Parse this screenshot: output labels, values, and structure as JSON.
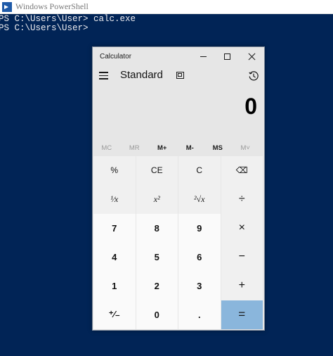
{
  "powershell": {
    "title": "Windows PowerShell",
    "lines": [
      "PS C:\\Users\\User> calc.exe",
      "PS C:\\Users\\User>"
    ]
  },
  "calculator": {
    "title": "Calculator",
    "mode": "Standard",
    "display": "0",
    "memory": [
      "MC",
      "MR",
      "M+",
      "M-",
      "MS",
      "M˅"
    ],
    "keys": {
      "percent": "%",
      "clear_entry": "CE",
      "clear": "C",
      "backspace": "⌫",
      "reciprocal": "¹⁄x",
      "square": "x²",
      "sqrt": "²√x",
      "divide": "÷",
      "seven": "7",
      "eight": "8",
      "nine": "9",
      "multiply": "×",
      "four": "4",
      "five": "5",
      "six": "6",
      "minus": "−",
      "one": "1",
      "two": "2",
      "three": "3",
      "plus": "+",
      "negate": "⁺⁄₋",
      "zero": "0",
      "decimal": ".",
      "equals": "="
    }
  },
  "colors": {
    "console_bg": "#012456",
    "equals_key": "#8ab6dc"
  }
}
